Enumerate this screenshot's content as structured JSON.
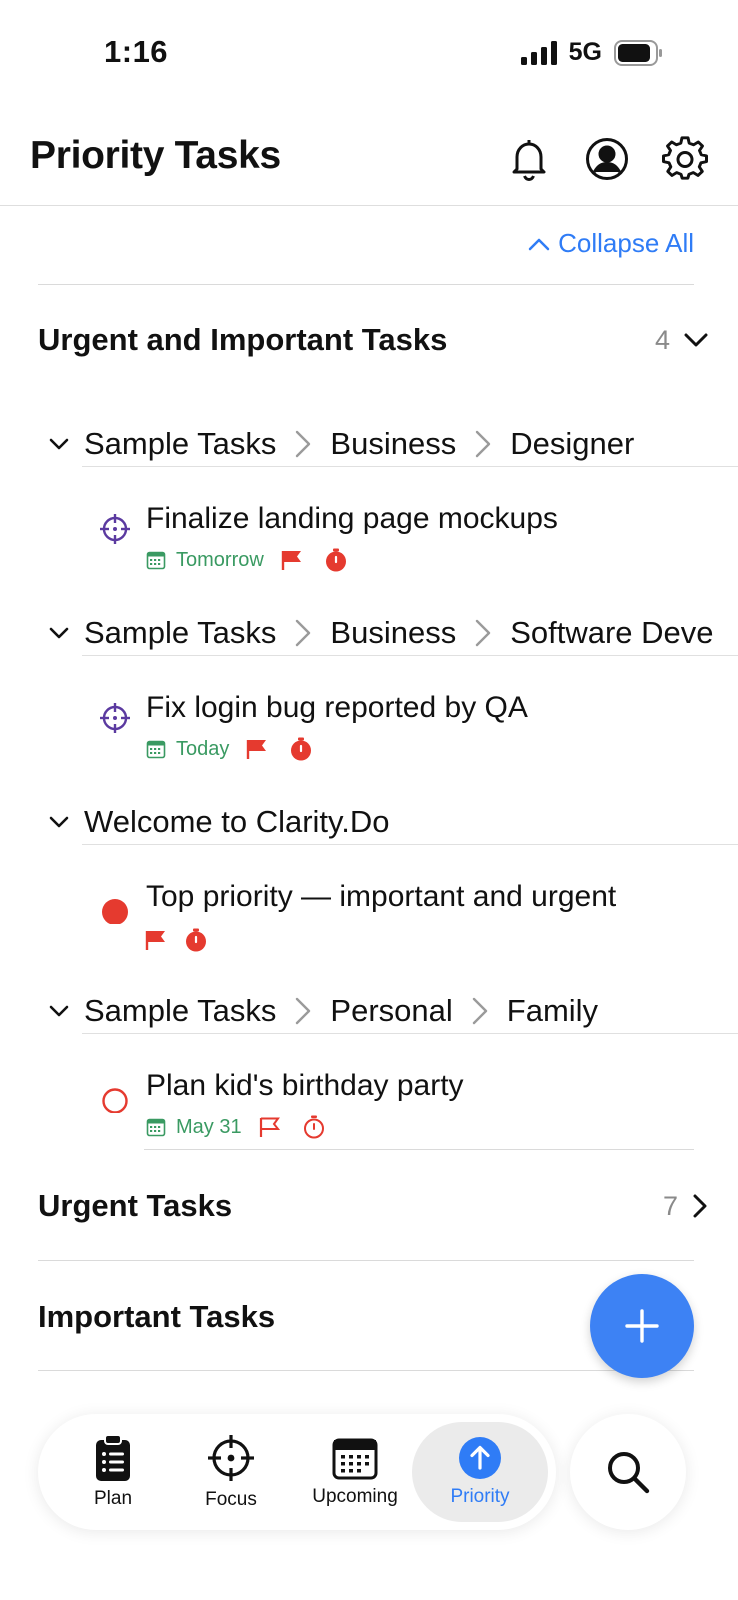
{
  "status_bar": {
    "time": "1:16",
    "network": "5G"
  },
  "header": {
    "title": "Priority Tasks"
  },
  "collapse_all_label": "Collapse All",
  "sections": {
    "urgent_important": {
      "name": "Urgent and Important Tasks",
      "count": "4"
    },
    "urgent": {
      "name": "Urgent Tasks",
      "count": "7"
    },
    "important": {
      "name": "Important Tasks"
    }
  },
  "groups": [
    {
      "crumbs": [
        "Sample Tasks",
        "Business",
        "Designer"
      ]
    },
    {
      "crumbs": [
        "Sample Tasks",
        "Business",
        "Software Deve"
      ]
    },
    {
      "crumbs": [
        "Welcome to Clarity.Do"
      ]
    },
    {
      "crumbs": [
        "Sample Tasks",
        "Personal",
        "Family"
      ]
    }
  ],
  "tasks": [
    {
      "title": "Finalize landing page mockups",
      "date": "Tomorrow",
      "marker": "focus-icon"
    },
    {
      "title": "Fix login bug reported by QA",
      "date": "Today",
      "marker": "focus-icon"
    },
    {
      "title": "Top priority — important and urgent",
      "date": "",
      "marker": "filled-circle-icon"
    },
    {
      "title": "Plan kid's birthday party",
      "date": "May 31",
      "marker": "empty-circle-icon"
    }
  ],
  "tabs": [
    {
      "label": "Plan",
      "icon": "clipboard-icon"
    },
    {
      "label": "Focus",
      "icon": "crosshair-icon"
    },
    {
      "label": "Upcoming",
      "icon": "calendar-icon"
    },
    {
      "label": "Priority",
      "icon": "arrow-up-icon",
      "active": true
    }
  ],
  "colors": {
    "accent": "#2f7cf6",
    "danger": "#e53a2f",
    "date_green": "#3a9a62",
    "focus_purple": "#5b3aa0"
  }
}
